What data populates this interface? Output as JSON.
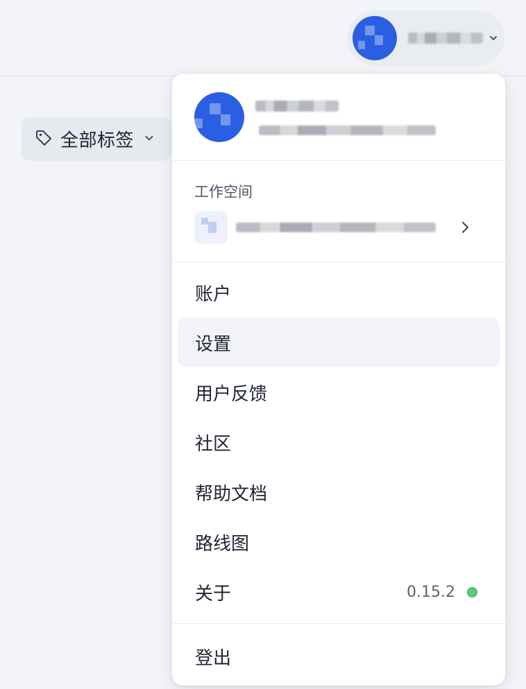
{
  "tag_filter": {
    "label": "全部标签",
    "icon": "tag-icon"
  },
  "menu": {
    "workspace_title": "工作空间",
    "items": [
      {
        "label": "账户"
      },
      {
        "label": "设置"
      },
      {
        "label": "用户反馈"
      },
      {
        "label": "社区"
      },
      {
        "label": "帮助文档"
      },
      {
        "label": "路线图"
      },
      {
        "label": "关于"
      }
    ],
    "version": "0.15.2",
    "status_color": "#5cc97a",
    "logout_label": "登出"
  },
  "colors": {
    "avatar": "#2a5fe3",
    "background": "#f2f4f7"
  }
}
